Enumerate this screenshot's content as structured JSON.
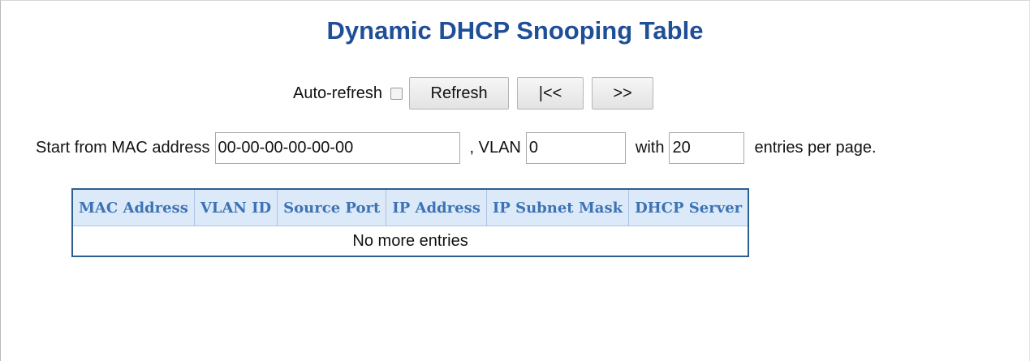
{
  "title": "Dynamic DHCP Snooping Table",
  "controls": {
    "auto_refresh_label": "Auto-refresh",
    "auto_refresh_checked": false,
    "refresh_label": "Refresh",
    "first_label": "|<<",
    "next_label": ">>"
  },
  "filter": {
    "start_label": "Start from MAC address",
    "mac_value": "00-00-00-00-00-00",
    "vlan_label": ", VLAN",
    "vlan_value": "0",
    "with_label": "with",
    "entries_value": "20",
    "entries_suffix": "entries per page."
  },
  "table": {
    "headers": [
      "MAC Address",
      "VLAN ID",
      "Source Port",
      "IP Address",
      "IP Subnet Mask",
      "DHCP Server"
    ],
    "empty_message": "No more entries"
  }
}
